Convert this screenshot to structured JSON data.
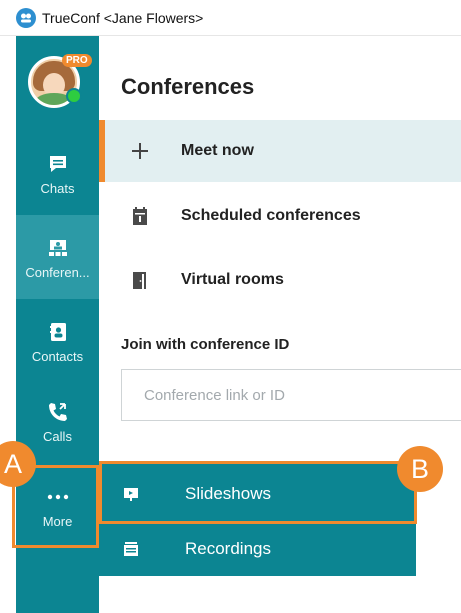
{
  "titlebar": {
    "title": "TrueConf <Jane Flowers>"
  },
  "profile": {
    "badge": "PRO"
  },
  "sidebar": {
    "items": [
      {
        "label": "Chats",
        "icon": "chat-icon"
      },
      {
        "label": "Conferen...",
        "icon": "conference-icon",
        "active": true
      },
      {
        "label": "Contacts",
        "icon": "contacts-icon"
      },
      {
        "label": "Calls",
        "icon": "calls-icon"
      },
      {
        "label": "More",
        "icon": "more-icon"
      }
    ]
  },
  "main": {
    "title": "Conferences",
    "menu": [
      {
        "label": "Meet now",
        "icon": "plus-icon",
        "selected": true
      },
      {
        "label": "Scheduled conferences",
        "icon": "calendar-icon"
      },
      {
        "label": "Virtual rooms",
        "icon": "door-icon"
      }
    ],
    "join_label": "Join with conference ID",
    "join_placeholder": "Conference link or ID"
  },
  "more_menu": {
    "items": [
      {
        "label": "Slideshows",
        "icon": "slideshow-icon"
      },
      {
        "label": "Recordings",
        "icon": "recordings-icon"
      }
    ]
  },
  "annotations": {
    "a": "A",
    "b": "B"
  },
  "colors": {
    "sidebar": "#0c8592",
    "accent": "#f08a2e",
    "selected_bg": "#e2eff1"
  }
}
